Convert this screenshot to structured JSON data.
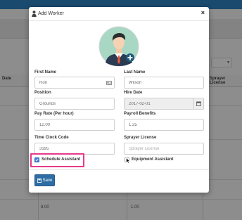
{
  "background": {
    "table_headers": [
      "Date",
      "Sprayer License"
    ],
    "cells": [
      "8.00",
      "1.00"
    ]
  },
  "modal": {
    "title": "Add Worker",
    "close_symbol": "×",
    "fields": {
      "first_name": {
        "label": "First Name",
        "value": "Ron"
      },
      "last_name": {
        "label": "Last Name",
        "value": "Wilson"
      },
      "position": {
        "label": "Position",
        "value": "Grounds"
      },
      "hire_date": {
        "label": "Hire Date",
        "value": "2017-02-01"
      },
      "pay_rate": {
        "label": "Pay Rate (Per hour)",
        "value": "12.00"
      },
      "payroll_benefits": {
        "label": "Payroll Benefits",
        "value": "1.25"
      },
      "time_clock_code": {
        "label": "Time Clock Code",
        "value": "3195"
      },
      "sprayer_license": {
        "label": "Sprayer License",
        "placeholder": "Sprayer License"
      }
    },
    "checkboxes": {
      "schedule_assistant": {
        "label": "Schedule Assistant",
        "checked": true
      },
      "equipment_assistant": {
        "label": "Equipment Assistant",
        "checked": false
      }
    },
    "save_label": "Save"
  },
  "colors": {
    "primary": "#2e6da4",
    "highlight": "#e6398a",
    "avatar_bg": "#a8d8c4"
  },
  "icons": [
    "user-icon",
    "close-icon",
    "avatar-add-icon",
    "contact-card-icon",
    "calendar-icon",
    "save-icon",
    "cursor-icon"
  ]
}
